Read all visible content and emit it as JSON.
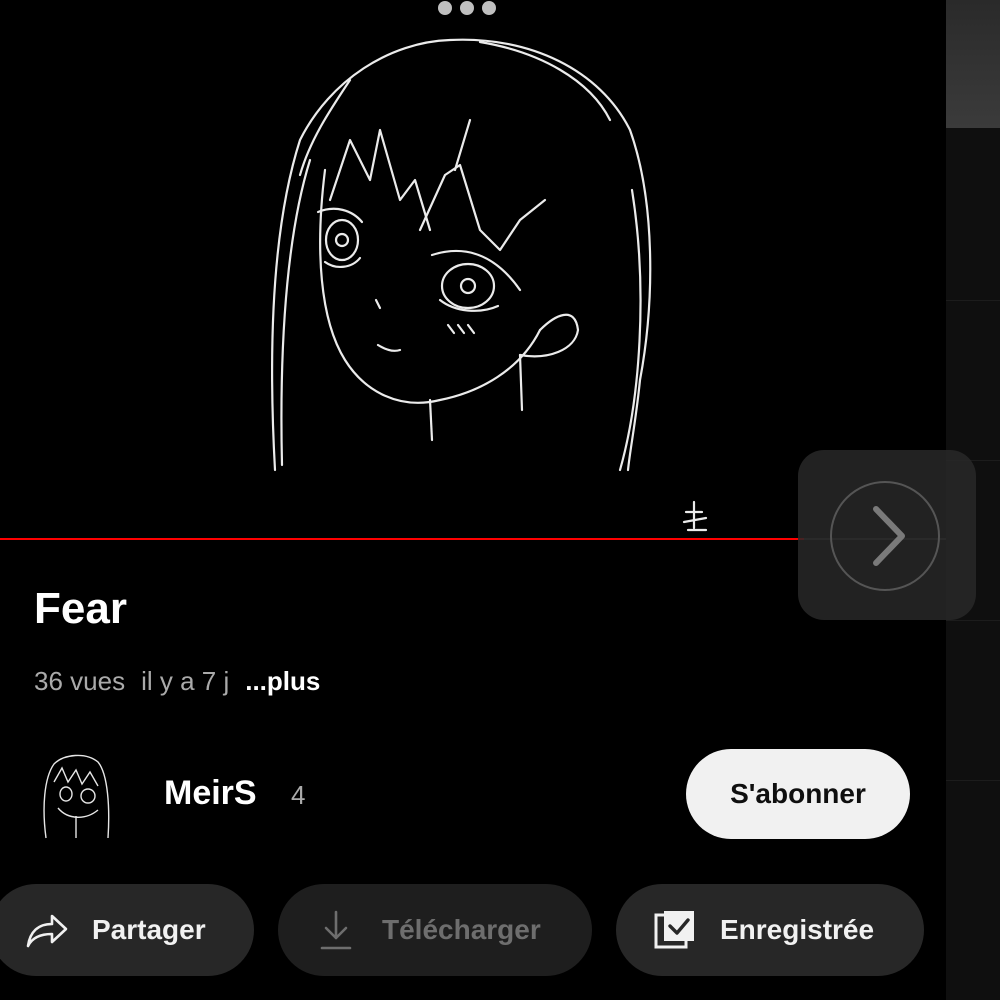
{
  "video": {
    "title": "Fear",
    "views": "36 vues",
    "age": "il y a 7 j",
    "more_label": "...plus",
    "progress_fraction": 0.85,
    "progress_color": "#ff0000"
  },
  "channel": {
    "name": "MeirS",
    "subscriber_count": "4",
    "subscribe_label": "S'abonner"
  },
  "actions": {
    "share_label": "Partager",
    "download_label": "Télécharger",
    "save_label": "Enregistrée"
  },
  "icons": {
    "menu": "more-dots-icon",
    "next": "chevron-right-icon",
    "share": "share-arrow-icon",
    "download": "download-icon",
    "save": "saved-checkbox-icon"
  }
}
